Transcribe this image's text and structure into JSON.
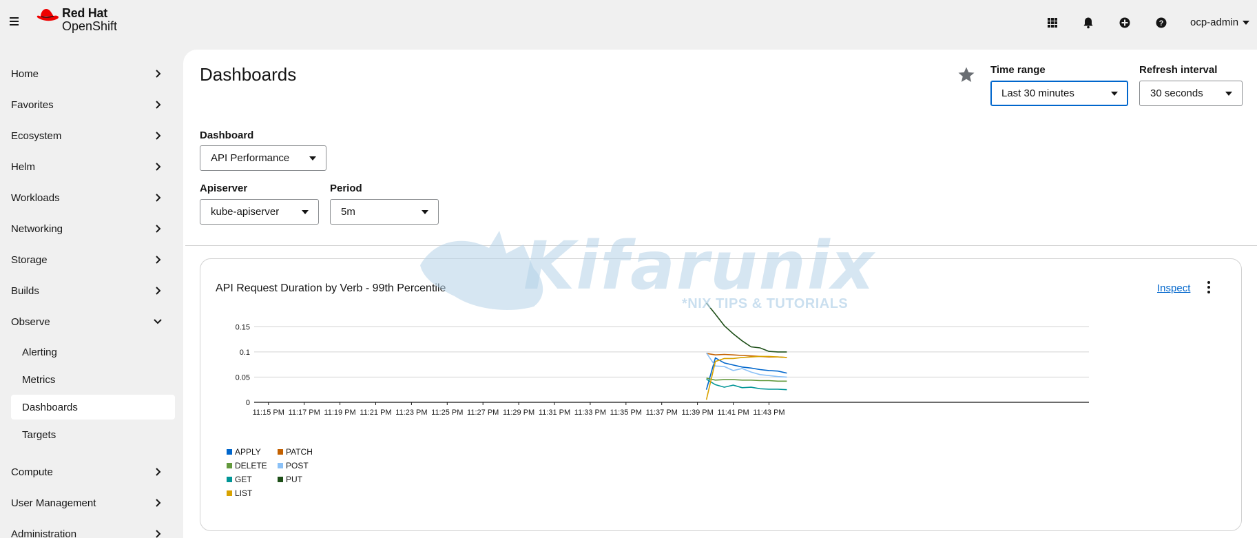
{
  "masthead": {
    "brand_top": "Red Hat",
    "brand_bottom": "OpenShift",
    "icons": [
      "apps-grid-icon",
      "bell-icon",
      "plus-circle-icon",
      "help-icon"
    ],
    "user": "ocp-admin"
  },
  "sidebar": {
    "items": [
      {
        "label": "Home"
      },
      {
        "label": "Favorites"
      },
      {
        "label": "Ecosystem"
      },
      {
        "label": "Helm"
      },
      {
        "label": "Workloads"
      },
      {
        "label": "Networking"
      },
      {
        "label": "Storage"
      },
      {
        "label": "Builds"
      },
      {
        "label": "Observe"
      },
      {
        "label": "Compute"
      },
      {
        "label": "User Management"
      },
      {
        "label": "Administration"
      }
    ],
    "observe_children": [
      {
        "label": "Alerting"
      },
      {
        "label": "Metrics"
      },
      {
        "label": "Dashboards"
      },
      {
        "label": "Targets"
      }
    ]
  },
  "page": {
    "title": "Dashboards",
    "time_range_label": "Time range",
    "time_range_value": "Last 30 minutes",
    "refresh_label": "Refresh interval",
    "refresh_value": "30 seconds",
    "dashboard_label": "Dashboard",
    "dashboard_value": "API Performance",
    "apiserver_label": "Apiserver",
    "apiserver_value": "kube-apiserver",
    "period_label": "Period",
    "period_value": "5m"
  },
  "card": {
    "title": "API Request Duration by Verb - 99th Percentile",
    "inspect_label": "Inspect"
  },
  "watermark": {
    "text": "Kifarunix",
    "subtext": "*NIX TIPS & TUTORIALS"
  },
  "chart_data": {
    "type": "line",
    "title": "API Request Duration by Verb - 99th Percentile",
    "xlabel": "",
    "ylabel": "",
    "ylim": [
      0,
      0.175
    ],
    "yticks": [
      "0",
      "0.05",
      "0.1",
      "0.15"
    ],
    "xticks": [
      "11:15 PM",
      "11:17 PM",
      "11:19 PM",
      "11:21 PM",
      "11:23 PM",
      "11:25 PM",
      "11:27 PM",
      "11:29 PM",
      "11:31 PM",
      "11:33 PM",
      "11:35 PM",
      "11:37 PM",
      "11:39 PM",
      "11:41 PM",
      "11:43 PM"
    ],
    "grid": true,
    "legend_position": "bottom-left",
    "x": [
      "11:39:30 PM",
      "11:40:00 PM",
      "11:40:30 PM",
      "11:41:00 PM",
      "11:41:30 PM",
      "11:42:00 PM",
      "11:42:30 PM",
      "11:43:00 PM",
      "11:43:30 PM",
      "11:44:00 PM"
    ],
    "series": [
      {
        "name": "APPLY",
        "color": "#0066cc",
        "values": [
          0.025,
          0.088,
          0.078,
          0.074,
          0.07,
          0.068,
          0.065,
          0.063,
          0.062,
          0.058
        ]
      },
      {
        "name": "PATCH",
        "color": "#c46100",
        "values": [
          0.097,
          0.094,
          0.095,
          0.094,
          0.093,
          0.092,
          0.091,
          0.09,
          0.09,
          0.089
        ]
      },
      {
        "name": "DELETE",
        "color": "#63993d",
        "values": [
          0.048,
          0.044,
          0.045,
          0.045,
          0.044,
          0.044,
          0.043,
          0.043,
          0.042,
          0.042
        ]
      },
      {
        "name": "POST",
        "color": "#8bc1f7",
        "values": [
          0.098,
          0.072,
          0.071,
          0.063,
          0.067,
          0.06,
          0.055,
          0.053,
          0.051,
          0.05
        ]
      },
      {
        "name": "GET",
        "color": "#009596",
        "values": [
          0.046,
          0.035,
          0.03,
          0.034,
          0.029,
          0.03,
          0.027,
          0.026,
          0.026,
          0.025
        ]
      },
      {
        "name": "PUT",
        "color": "#1e4f18",
        "values": [
          0.197,
          0.175,
          0.152,
          0.136,
          0.122,
          0.11,
          0.108,
          0.101,
          0.1,
          0.1
        ]
      },
      {
        "name": "LIST",
        "color": "#d8a200",
        "values": [
          0.005,
          0.081,
          0.087,
          0.087,
          0.089,
          0.09,
          0.091,
          0.091,
          0.09,
          0.089
        ]
      }
    ]
  }
}
